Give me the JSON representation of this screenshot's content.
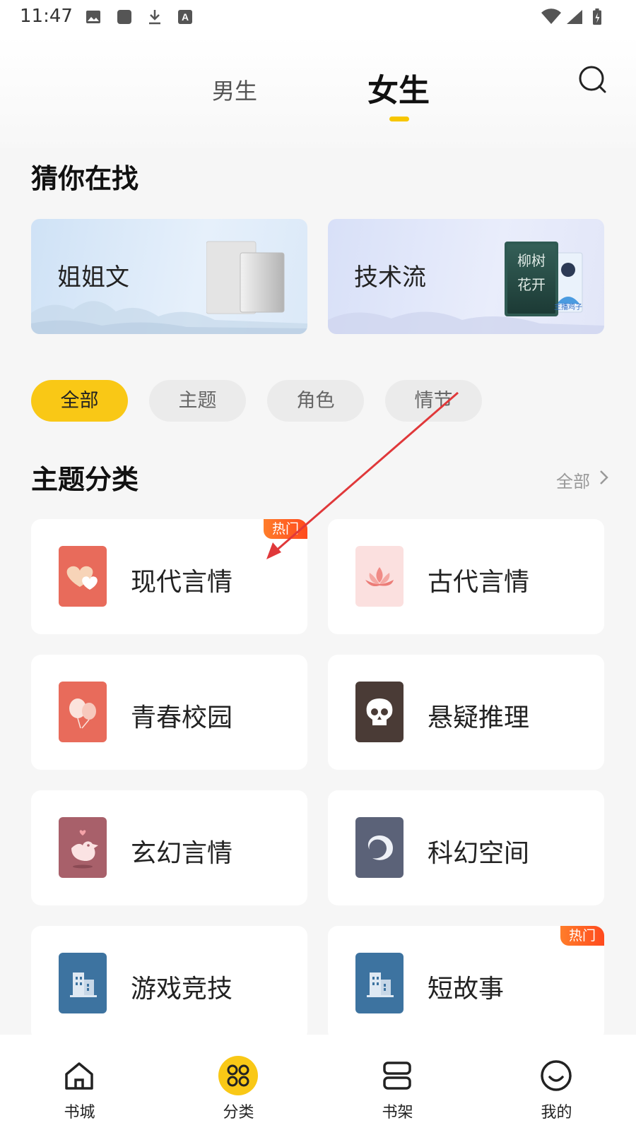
{
  "status_bar": {
    "time": "11:47"
  },
  "header": {
    "tabs": [
      {
        "label": "男生",
        "active": false
      },
      {
        "label": "女生",
        "active": true
      }
    ],
    "search_icon": "search-icon",
    "accent_color": "#f7c600"
  },
  "guess": {
    "title": "猜你在找",
    "cards": [
      {
        "label": "姐姐文"
      },
      {
        "label": "技术流",
        "cover_text": [
          "柳树",
          "花开"
        ],
        "cover_text_2": "主播鸡子"
      }
    ]
  },
  "filters": {
    "chips": [
      {
        "label": "全部",
        "active": true
      },
      {
        "label": "主题",
        "active": false
      },
      {
        "label": "角色",
        "active": false
      },
      {
        "label": "情节",
        "active": false
      }
    ]
  },
  "topics": {
    "title": "主题分类",
    "more_label": "全部",
    "badge_label": "热门",
    "items": [
      {
        "label": "现代言情",
        "icon": "hearts-icon",
        "hot": true,
        "icon_bg": "#e86b5b"
      },
      {
        "label": "古代言情",
        "icon": "lotus-icon",
        "hot": false,
        "icon_bg": "#fbe0df"
      },
      {
        "label": "青春校园",
        "icon": "balloons-icon",
        "hot": false,
        "icon_bg": "#e86b5b"
      },
      {
        "label": "悬疑推理",
        "icon": "skull-icon",
        "hot": false,
        "icon_bg": "#4a3b36"
      },
      {
        "label": "玄幻言情",
        "icon": "bird-icon",
        "hot": false,
        "icon_bg": "#a8606a"
      },
      {
        "label": "科幻空间",
        "icon": "swirl-icon",
        "hot": false,
        "icon_bg": "#5b6278"
      },
      {
        "label": "游戏竞技",
        "icon": "building-icon",
        "hot": false,
        "icon_bg": "#3d73a0"
      },
      {
        "label": "短故事",
        "icon": "building-icon",
        "hot": true,
        "icon_bg": "#3d73a0"
      }
    ]
  },
  "bottom_nav": {
    "items": [
      {
        "label": "书城",
        "icon": "home-icon",
        "active": false
      },
      {
        "label": "分类",
        "icon": "category-icon",
        "active": true
      },
      {
        "label": "书架",
        "icon": "bookshelf-icon",
        "active": false
      },
      {
        "label": "我的",
        "icon": "smile-icon",
        "active": false
      }
    ]
  }
}
